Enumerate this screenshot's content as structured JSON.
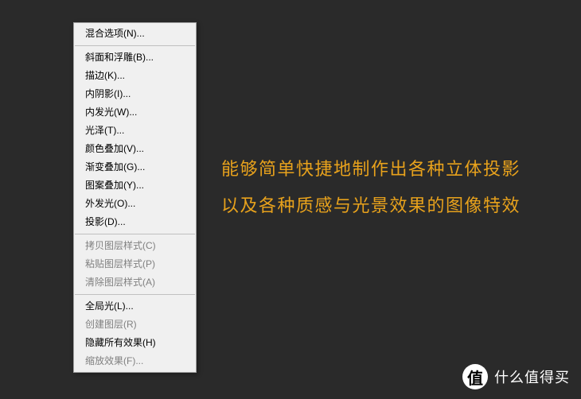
{
  "menu": {
    "section1": [
      {
        "label": "混合选项(N)..."
      }
    ],
    "section2": [
      {
        "label": "斜面和浮雕(B)..."
      },
      {
        "label": "描边(K)..."
      },
      {
        "label": "内阴影(I)..."
      },
      {
        "label": "内发光(W)..."
      },
      {
        "label": "光泽(T)..."
      },
      {
        "label": "颜色叠加(V)..."
      },
      {
        "label": "渐变叠加(G)..."
      },
      {
        "label": "图案叠加(Y)..."
      },
      {
        "label": "外发光(O)..."
      },
      {
        "label": "投影(D)..."
      }
    ],
    "section3": [
      {
        "label": "拷贝图层样式(C)",
        "disabled": true
      },
      {
        "label": "粘贴图层样式(P)",
        "disabled": true
      },
      {
        "label": "清除图层样式(A)",
        "disabled": true
      }
    ],
    "section4": [
      {
        "label": "全局光(L)..."
      },
      {
        "label": "创建图层(R)",
        "disabled": true
      },
      {
        "label": "隐藏所有效果(H)"
      },
      {
        "label": "缩放效果(F)...",
        "disabled": true
      }
    ]
  },
  "caption": {
    "line1": "能够简单快捷地制作出各种立体投影",
    "line2": "以及各种质感与光景效果的图像特效"
  },
  "watermark": {
    "icon_char": "值",
    "text": "什么值得买"
  }
}
